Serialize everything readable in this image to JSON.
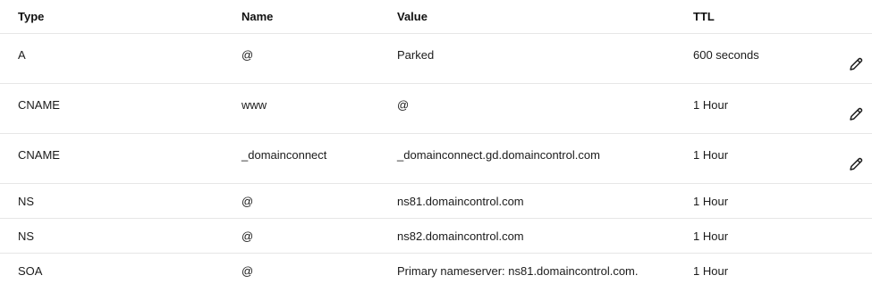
{
  "columns": {
    "type": "Type",
    "name": "Name",
    "value": "Value",
    "ttl": "TTL"
  },
  "records": [
    {
      "type": "A",
      "name": "@",
      "value": "Parked",
      "ttl": "600 seconds",
      "editable": true,
      "action_icon": "pencil-icon"
    },
    {
      "type": "CNAME",
      "name": "www",
      "value": "@",
      "ttl": "1 Hour",
      "editable": true,
      "action_icon": "pencil-icon"
    },
    {
      "type": "CNAME",
      "name": "_domainconnect",
      "value": "_domainconnect.gd.domaincontrol.com",
      "ttl": "1 Hour",
      "editable": true,
      "action_icon": "pencil-icon"
    },
    {
      "type": "NS",
      "name": "@",
      "value": "ns81.domaincontrol.com",
      "ttl": "1 Hour",
      "editable": false
    },
    {
      "type": "NS",
      "name": "@",
      "value": "ns82.domaincontrol.com",
      "ttl": "1 Hour",
      "editable": false
    },
    {
      "type": "SOA",
      "name": "@",
      "value": "Primary nameserver: ns81.domaincontrol.com.",
      "ttl": "1 Hour",
      "editable": false
    }
  ]
}
